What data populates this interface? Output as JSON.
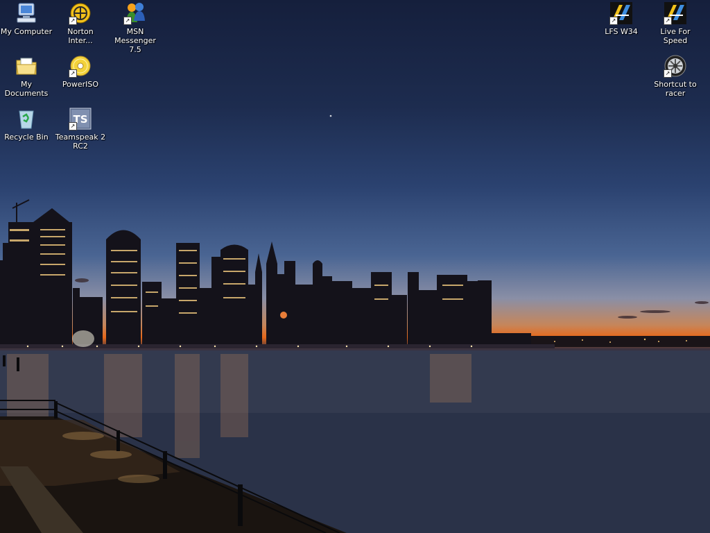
{
  "desktop": {
    "icons_left": [
      {
        "id": "my-computer",
        "label": "My Computer",
        "icon": "my-computer-icon",
        "shortcut": false
      },
      {
        "id": "norton",
        "label": "Norton\nInter...",
        "icon": "norton-internet-security-icon",
        "shortcut": true
      },
      {
        "id": "msn",
        "label": "MSN\nMessenger 7.5",
        "icon": "msn-messenger-icon",
        "shortcut": true
      },
      {
        "id": "my-documents",
        "label": "My Documents",
        "icon": "my-documents-folder-icon",
        "shortcut": false
      },
      {
        "id": "poweriso",
        "label": "PowerISO",
        "icon": "poweriso-disc-icon",
        "shortcut": true
      },
      {
        "id": "recycle-bin",
        "label": "Recycle Bin",
        "icon": "recycle-bin-icon",
        "shortcut": false
      },
      {
        "id": "teamspeak",
        "label": "Teamspeak 2\nRC2",
        "icon": "teamspeak-icon",
        "shortcut": true
      }
    ],
    "icons_right": [
      {
        "id": "lfs-w34",
        "label": "LFS W34",
        "icon": "lfs-icon",
        "shortcut": true
      },
      {
        "id": "live-for-speed",
        "label": "Live For Speed",
        "icon": "lfs-icon",
        "shortcut": true
      },
      {
        "id": "racer",
        "label": "Shortcut to\nracer",
        "icon": "wheel-rim-icon",
        "shortcut": true
      }
    ],
    "wallpaper": "city-skyline-at-dusk",
    "colors": {
      "sky_top": "#151f3c",
      "horizon_orange": "#e7681a",
      "water": "#28324a",
      "label_text": "#ffffff"
    }
  }
}
